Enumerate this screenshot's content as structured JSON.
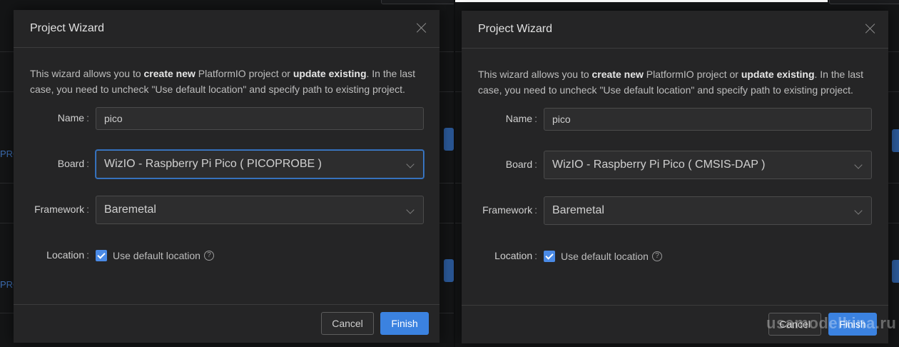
{
  "dialogs": [
    {
      "title": "Project Wizard",
      "description": {
        "part1": "This wizard allows you to ",
        "bold1": "create new",
        "part2": " PlatformIO project or ",
        "bold2": "update existing",
        "part3": ". In the last case, you need to uncheck \"Use default location\" and specify path to existing project."
      },
      "name_label": "Name",
      "name_value": "pico",
      "board_label": "Board",
      "board_value": "WizIO - Raspberry Pi Pico ( PICOPROBE )",
      "framework_label": "Framework",
      "framework_value": "Baremetal",
      "location_label": "Location",
      "use_default_location_label": "Use default location",
      "use_default_location_checked": true,
      "help_glyph": "?",
      "cancel_label": "Cancel",
      "finish_label": "Finish"
    },
    {
      "title": "Project Wizard",
      "description": {
        "part1": "This wizard allows you to ",
        "bold1": "create new",
        "part2": " PlatformIO project or ",
        "bold2": "update existing",
        "part3": ". In the last case, you need to uncheck \"Use default location\" and specify path to existing project."
      },
      "name_label": "Name",
      "name_value": "pico",
      "board_label": "Board",
      "board_value": "WizIO - Raspberry Pi Pico ( CMSIS-DAP )",
      "framework_label": "Framework",
      "framework_value": "Baremetal",
      "location_label": "Location",
      "use_default_location_label": "Use default location",
      "use_default_location_checked": true,
      "help_glyph": "?",
      "cancel_label": "Cancel",
      "finish_label": "Finish"
    }
  ],
  "background": {
    "left_side_text_1": "PRO",
    "left_side_text_2": "PRO"
  },
  "watermark": "usamodelkina.ru",
  "colors": {
    "dialog_bg": "#252526",
    "accent": "#3b82e0",
    "focus_border": "#3d7fd1"
  }
}
